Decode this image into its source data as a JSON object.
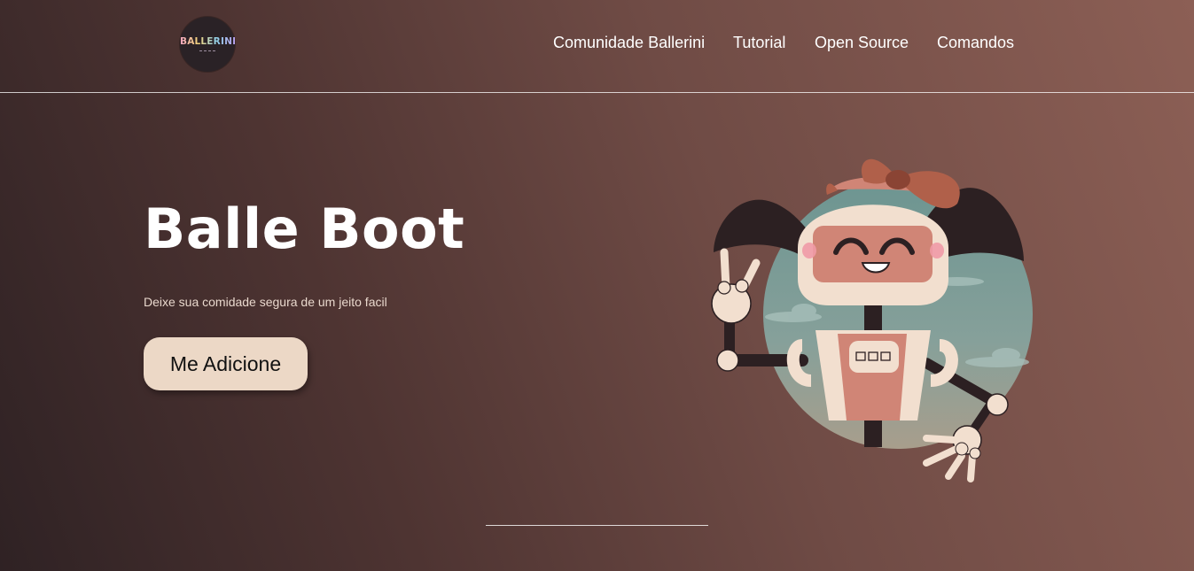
{
  "header": {
    "logo_text": "BALLERINI",
    "nav": [
      {
        "label": "Comunidade Ballerini"
      },
      {
        "label": "Tutorial"
      },
      {
        "label": "Open Source"
      },
      {
        "label": "Comandos"
      }
    ]
  },
  "hero": {
    "title": "Balle Boot",
    "subtitle": "Deixe sua comidade segura de um jeito facil",
    "cta_label": "Me Adicione"
  },
  "colors": {
    "bg_dark": "#2f2224",
    "bg_light": "#8c5f55",
    "button_bg": "#ecd8c6",
    "robot_pink": "#d08576",
    "robot_cream": "#f2dfcf",
    "hair": "#2c2022",
    "bow": "#b0604a",
    "circle_teal": "#7a9e98"
  },
  "illustration": {
    "icon": "robot-girl-mascot-illustration"
  }
}
